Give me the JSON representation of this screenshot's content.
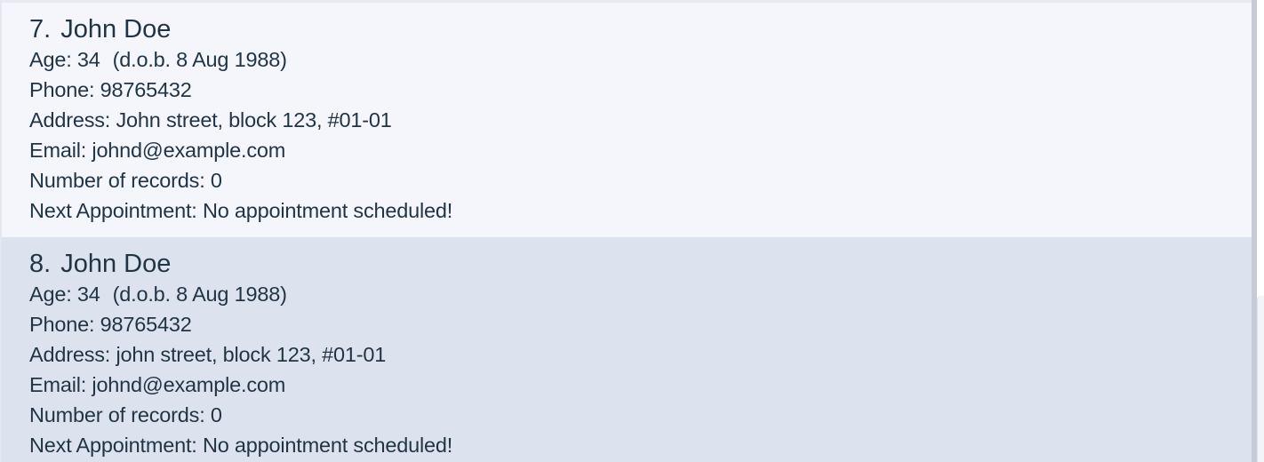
{
  "persons": [
    {
      "index": "7.",
      "name": "John Doe",
      "age": "Age: 34",
      "dob": "(d.o.b. 8 Aug 1988)",
      "phone": "Phone: 98765432",
      "address": "Address: John street, block 123, #01-01",
      "email": "Email: johnd@example.com",
      "records": "Number of records: 0",
      "appointment": "Next Appointment: No appointment scheduled!"
    },
    {
      "index": "8.",
      "name": "John Doe",
      "age": "Age: 34",
      "dob": "(d.o.b. 8 Aug 1988)",
      "phone": "Phone: 98765432",
      "address": "Address: john street, block 123, #01-01",
      "email": "Email: johnd@example.com",
      "records": "Number of records: 0",
      "appointment": "Next Appointment: No appointment scheduled!"
    }
  ],
  "colors": {
    "card_odd": "#f4f6fc",
    "card_even": "#dde3ee",
    "text": "#1f3445"
  }
}
